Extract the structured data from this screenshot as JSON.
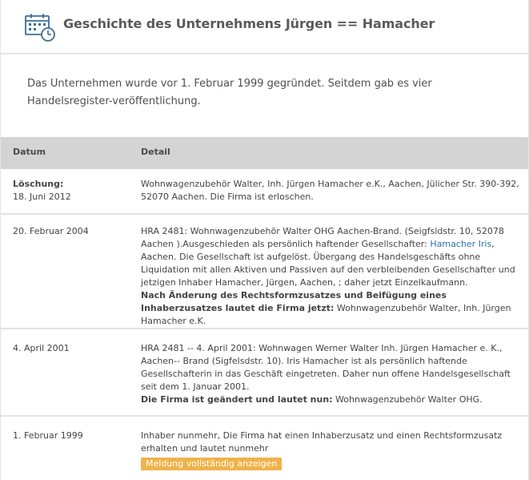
{
  "header": {
    "title": "Geschichte des Unternehmens Jürgen == Hamacher",
    "icon": "calendar-clock-icon"
  },
  "intro": "Das Unternehmen wurde vor 1. Februar 1999 gegründet. Seitdem gab es vier Handelsregister-veröffentlichung.",
  "table": {
    "columns": [
      "Datum",
      "Detail"
    ],
    "rows": [
      {
        "date_label": "Löschung:",
        "date": "18. Juni 2012",
        "detail_parts": [
          "Wohnwagenzubehör Walter, Inh. Jürgen Hamacher e.K., Aachen, Jülicher Str. 390-392, 52070 Aachen. Die Firma ist erloschen."
        ]
      },
      {
        "date": "20. Februar 2004",
        "detail_parts": [
          "HRA 2481: Wohnwagenzubehör Walter OHG Aachen-Brand. (Seigfsldstr. 10, 52078 Aachen ).Ausgeschieden als persönlich haftender Gesellschafter: ",
          "Hamacher Iris",
          ", Aachen. Die Gesellschaft ist aufgelöst. Übergang des Handelsgeschäfts ohne Liquidation mit allen Aktiven und Passiven auf den verbleibenden Gesellschafter und jetzigen Inhaber Hamacher, Jürgen, Aachen, ; daher jetzt Einzelkaufmann.",
          "Nach Änderung des Rechtsformzusatzes und Beifügung eines Inhaberzusatzes lautet die Firma jetzt:",
          " Wohnwagenzubehör Walter, Inh. Jürgen Hamacher e.K."
        ]
      },
      {
        "date": "4. April 2001",
        "detail_parts": [
          "HRA 2481 -- 4. April 2001: Wohnwagen Werner Walter Inh. Jürgen Hamacher e. K., Aachen-- Brand (Sigfelsdstr. 10). Iris Hamacher ist als persönlich haftende Gesellschafterin in das Geschäft eingetreten. Daher nun offene Handelsgesellschaft seit dem 1. Januar 2001.",
          "Die Firma ist geändert und lautet nun:",
          " Wohnwagenzubehör Walter OHG."
        ]
      },
      {
        "date": "1. Februar 1999",
        "detail_parts": [
          "Inhaber nunmehr, Die Firma hat einen Inhaberzusatz und einen Rechtsformzusatz erhalten und lautet nunmehr"
        ],
        "button": "Meldung vollständig anzeigen"
      }
    ]
  },
  "colors": {
    "header_bar": "#d4d4d4",
    "link": "#2a6fb0",
    "button": "#f0b24a"
  }
}
